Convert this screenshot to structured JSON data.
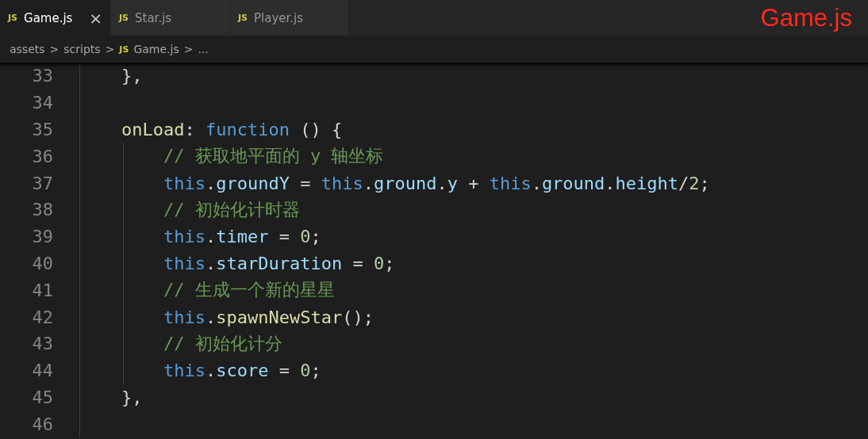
{
  "tabs": [
    {
      "icon": "JS",
      "label": "Game.js",
      "selected": true,
      "close": "×"
    },
    {
      "icon": "JS",
      "label": "Star.js",
      "selected": false
    },
    {
      "icon": "JS",
      "label": "Player.js",
      "selected": false
    }
  ],
  "overlay_title": "Game.js",
  "breadcrumb": [
    {
      "kind": "folder",
      "label": "assets"
    },
    {
      "kind": "sep",
      "label": ">"
    },
    {
      "kind": "folder",
      "label": "scripts"
    },
    {
      "kind": "sep",
      "label": ">"
    },
    {
      "kind": "file",
      "icon": "JS",
      "label": "Game.js"
    },
    {
      "kind": "sep",
      "label": ">"
    },
    {
      "kind": "folder",
      "label": "..."
    }
  ],
  "code_lines": [
    {
      "number": "33",
      "tokens": [
        {
          "kind": "punct",
          "text": "    },"
        }
      ]
    },
    {
      "number": "34"
    },
    {
      "number": "35",
      "tokens": [
        {
          "kind": "method",
          "text": "    onLoad"
        },
        {
          "kind": "punct",
          "text": ": "
        },
        {
          "kind": "keyword",
          "text": "function"
        },
        {
          "kind": "punct",
          "text": " () {"
        }
      ]
    },
    {
      "number": "36",
      "tokens": [
        {
          "kind": "comment",
          "text": "        // 获取地平面的 y 轴坐标"
        }
      ]
    },
    {
      "number": "37",
      "tokens": [
        {
          "kind": "keyword",
          "text": "        this"
        },
        {
          "kind": "punct",
          "text": "."
        },
        {
          "kind": "property",
          "text": "groundY"
        },
        {
          "kind": "punct",
          "text": " = "
        },
        {
          "kind": "keyword",
          "text": "this"
        },
        {
          "kind": "punct",
          "text": "."
        },
        {
          "kind": "property",
          "text": "ground"
        },
        {
          "kind": "punct",
          "text": "."
        },
        {
          "kind": "property",
          "text": "y"
        },
        {
          "kind": "punct",
          "text": " + "
        },
        {
          "kind": "keyword",
          "text": "this"
        },
        {
          "kind": "punct",
          "text": "."
        },
        {
          "kind": "property",
          "text": "ground"
        },
        {
          "kind": "punct",
          "text": "."
        },
        {
          "kind": "property",
          "text": "height"
        },
        {
          "kind": "punct",
          "text": "/"
        },
        {
          "kind": "number",
          "text": "2"
        },
        {
          "kind": "punct",
          "text": ";"
        }
      ]
    },
    {
      "number": "38",
      "tokens": [
        {
          "kind": "comment",
          "text": "        // 初始化计时器"
        }
      ]
    },
    {
      "number": "39",
      "tokens": [
        {
          "kind": "keyword",
          "text": "        this"
        },
        {
          "kind": "punct",
          "text": "."
        },
        {
          "kind": "property",
          "text": "timer"
        },
        {
          "kind": "punct",
          "text": " = "
        },
        {
          "kind": "number",
          "text": "0"
        },
        {
          "kind": "punct",
          "text": ";"
        }
      ]
    },
    {
      "number": "40",
      "tokens": [
        {
          "kind": "keyword",
          "text": "        this"
        },
        {
          "kind": "punct",
          "text": "."
        },
        {
          "kind": "property",
          "text": "starDuration"
        },
        {
          "kind": "punct",
          "text": " = "
        },
        {
          "kind": "number",
          "text": "0"
        },
        {
          "kind": "punct",
          "text": ";"
        }
      ]
    },
    {
      "number": "41",
      "tokens": [
        {
          "kind": "comment",
          "text": "        // 生成一个新的星星"
        }
      ]
    },
    {
      "number": "42",
      "tokens": [
        {
          "kind": "keyword",
          "text": "        this"
        },
        {
          "kind": "punct",
          "text": "."
        },
        {
          "kind": "method",
          "text": "spawnNewStar"
        },
        {
          "kind": "punct",
          "text": "();"
        }
      ]
    },
    {
      "number": "43",
      "tokens": [
        {
          "kind": "comment",
          "text": "        // 初始化计分"
        }
      ]
    },
    {
      "number": "44",
      "tokens": [
        {
          "kind": "keyword",
          "text": "        this"
        },
        {
          "kind": "punct",
          "text": "."
        },
        {
          "kind": "property",
          "text": "score"
        },
        {
          "kind": "punct",
          "text": " = "
        },
        {
          "kind": "number",
          "text": "0"
        },
        {
          "kind": "punct",
          "text": ";"
        }
      ]
    },
    {
      "number": "45",
      "tokens": [
        {
          "kind": "punct",
          "text": "    },"
        }
      ]
    },
    {
      "number": "46"
    }
  ]
}
